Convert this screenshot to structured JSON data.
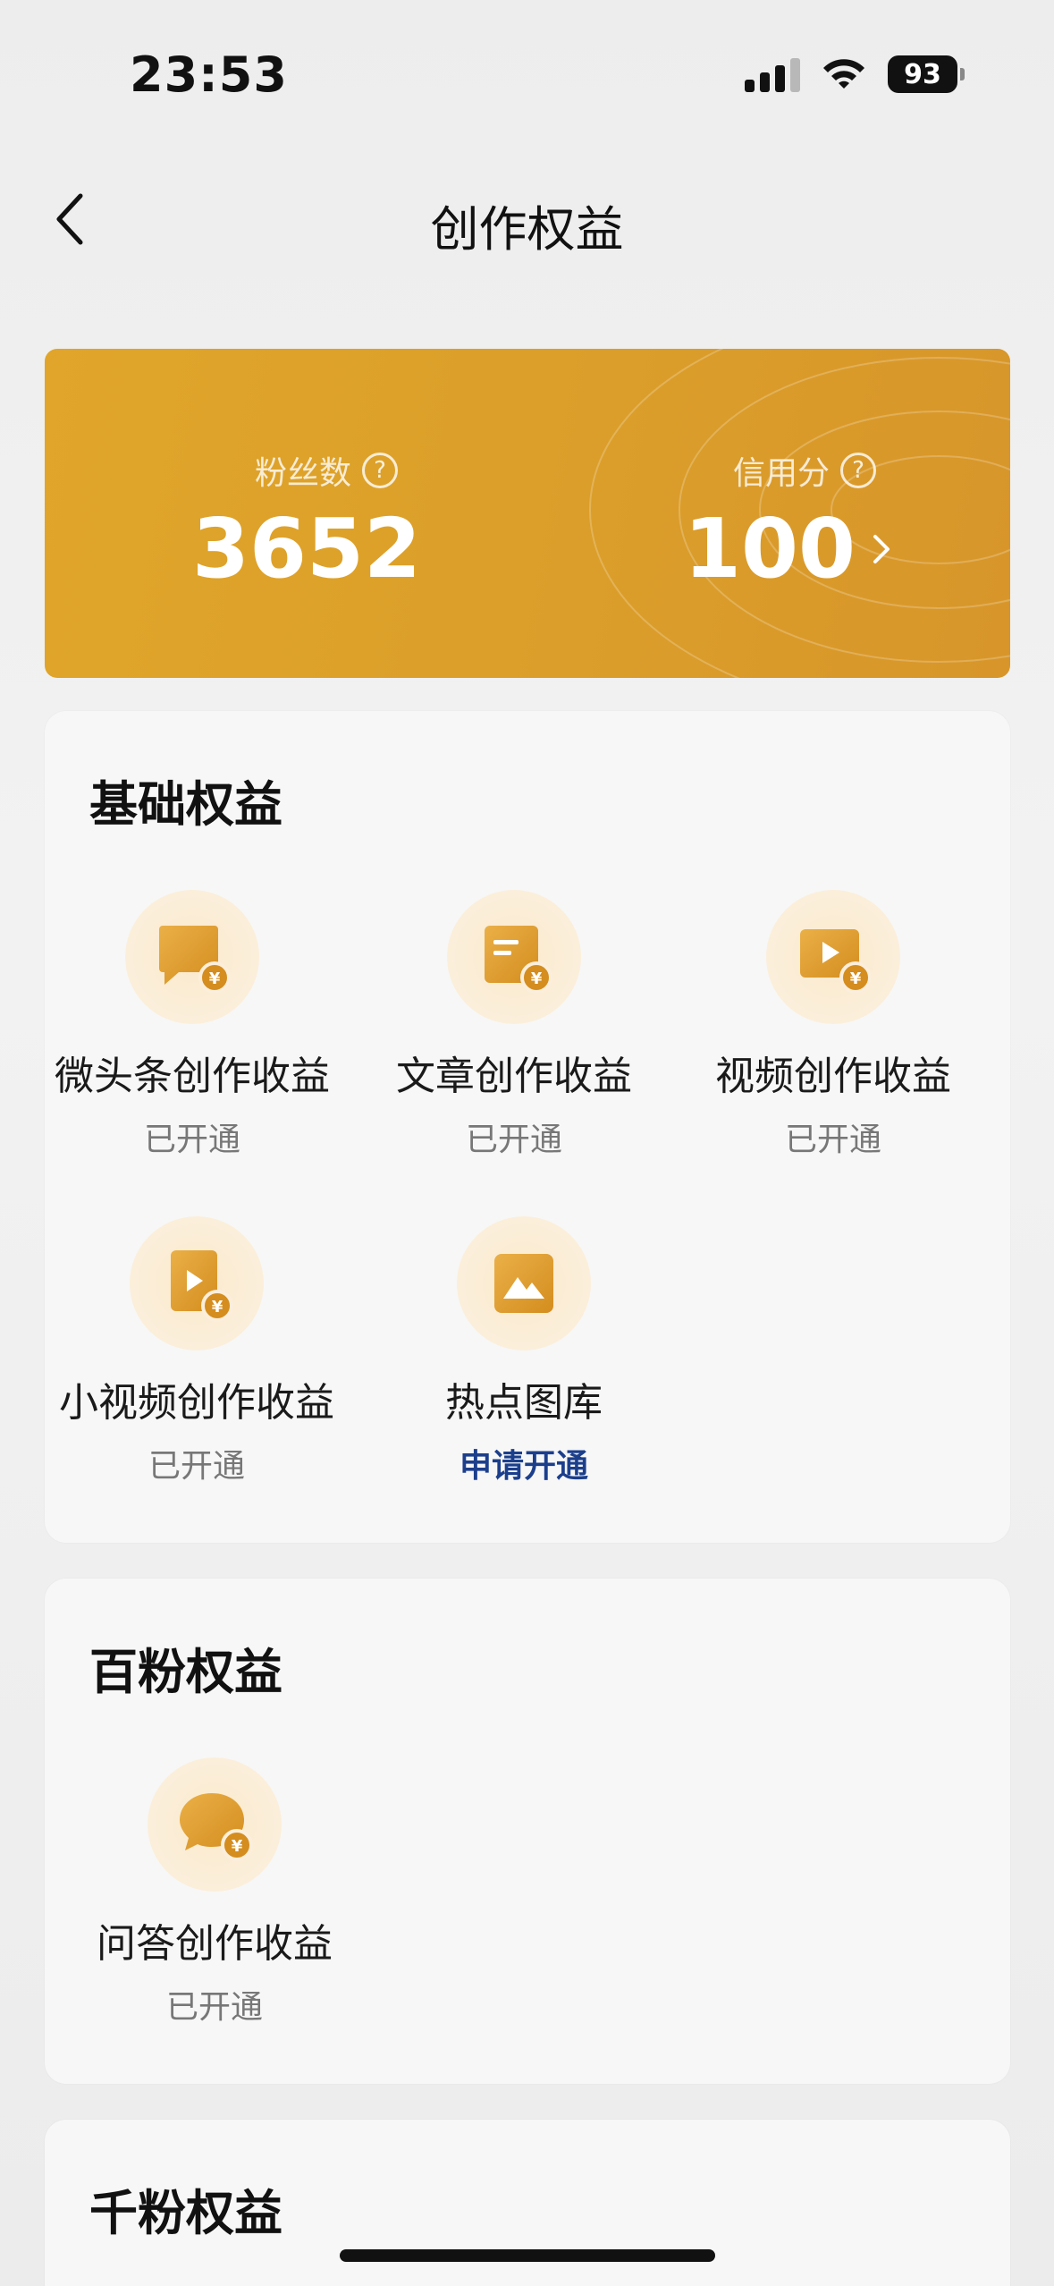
{
  "status_bar": {
    "time": "23:53",
    "battery": "93"
  },
  "nav": {
    "title": "创作权益"
  },
  "stats": {
    "fans_label": "粉丝数",
    "fans_value": "3652",
    "credit_label": "信用分",
    "credit_value": "100"
  },
  "basic": {
    "title": "基础权益",
    "items": [
      {
        "label": "微头条创作收益",
        "status": "已开通",
        "icon": "chat-bubble-yuan-icon"
      },
      {
        "label": "文章创作收益",
        "status": "已开通",
        "icon": "article-yuan-icon"
      },
      {
        "label": "视频创作收益",
        "status": "已开通",
        "icon": "video-yuan-icon"
      },
      {
        "label": "小视频创作收益",
        "status": "已开通",
        "icon": "short-video-yuan-icon"
      },
      {
        "label": "热点图库",
        "status": "申请开通",
        "icon": "image-gallery-icon"
      }
    ]
  },
  "hundred": {
    "title": "百粉权益",
    "items": [
      {
        "label": "问答创作收益",
        "status": "已开通",
        "icon": "qa-bubble-yuan-icon"
      }
    ]
  },
  "thousand": {
    "title": "千粉权益"
  },
  "colors": {
    "gold": "#dca02a",
    "icon_bg": "#fbeedb",
    "apply_link": "#1c3f8c"
  }
}
